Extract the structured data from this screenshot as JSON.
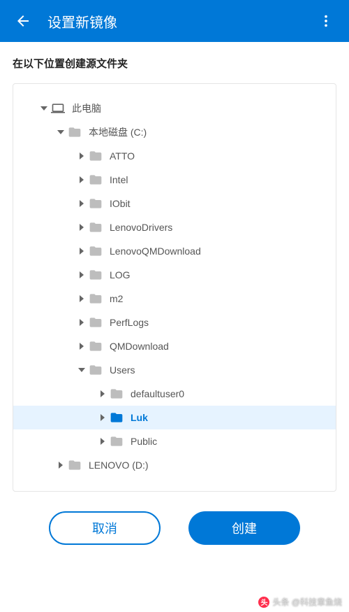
{
  "header": {
    "title": "设置新镜像"
  },
  "subtitle": "在以下位置创建源文件夹",
  "tree": [
    {
      "indent": 0,
      "arrow": "down",
      "icon": "computer",
      "label": "此电脑",
      "selected": false
    },
    {
      "indent": 1,
      "arrow": "down",
      "icon": "folder",
      "label": "本地磁盘 (C:)",
      "selected": false
    },
    {
      "indent": 2,
      "arrow": "right",
      "icon": "folder",
      "label": "ATTO",
      "selected": false
    },
    {
      "indent": 2,
      "arrow": "right",
      "icon": "folder",
      "label": "Intel",
      "selected": false
    },
    {
      "indent": 2,
      "arrow": "right",
      "icon": "folder",
      "label": "IObit",
      "selected": false
    },
    {
      "indent": 2,
      "arrow": "right",
      "icon": "folder",
      "label": "LenovoDrivers",
      "selected": false
    },
    {
      "indent": 2,
      "arrow": "right",
      "icon": "folder",
      "label": "LenovoQMDownload",
      "selected": false
    },
    {
      "indent": 2,
      "arrow": "right",
      "icon": "folder",
      "label": "LOG",
      "selected": false
    },
    {
      "indent": 2,
      "arrow": "right",
      "icon": "folder",
      "label": "m2",
      "selected": false
    },
    {
      "indent": 2,
      "arrow": "right",
      "icon": "folder",
      "label": "PerfLogs",
      "selected": false
    },
    {
      "indent": 2,
      "arrow": "right",
      "icon": "folder",
      "label": "QMDownload",
      "selected": false
    },
    {
      "indent": 3,
      "arrow": "down",
      "icon": "folder",
      "label": "Users",
      "selected": false
    },
    {
      "indent": 4,
      "arrow": "right",
      "icon": "folder",
      "label": "defaultuser0",
      "selected": false
    },
    {
      "indent": 4,
      "arrow": "right",
      "icon": "folder",
      "label": "Luk",
      "selected": true
    },
    {
      "indent": 4,
      "arrow": "right",
      "icon": "folder",
      "label": "Public",
      "selected": false
    },
    {
      "indent": 1,
      "arrow": "right",
      "icon": "folder",
      "label": "LENOVO (D:)",
      "selected": false
    }
  ],
  "buttons": {
    "cancel": "取消",
    "create": "创建"
  },
  "watermark": "头条 @科技章鱼烧"
}
